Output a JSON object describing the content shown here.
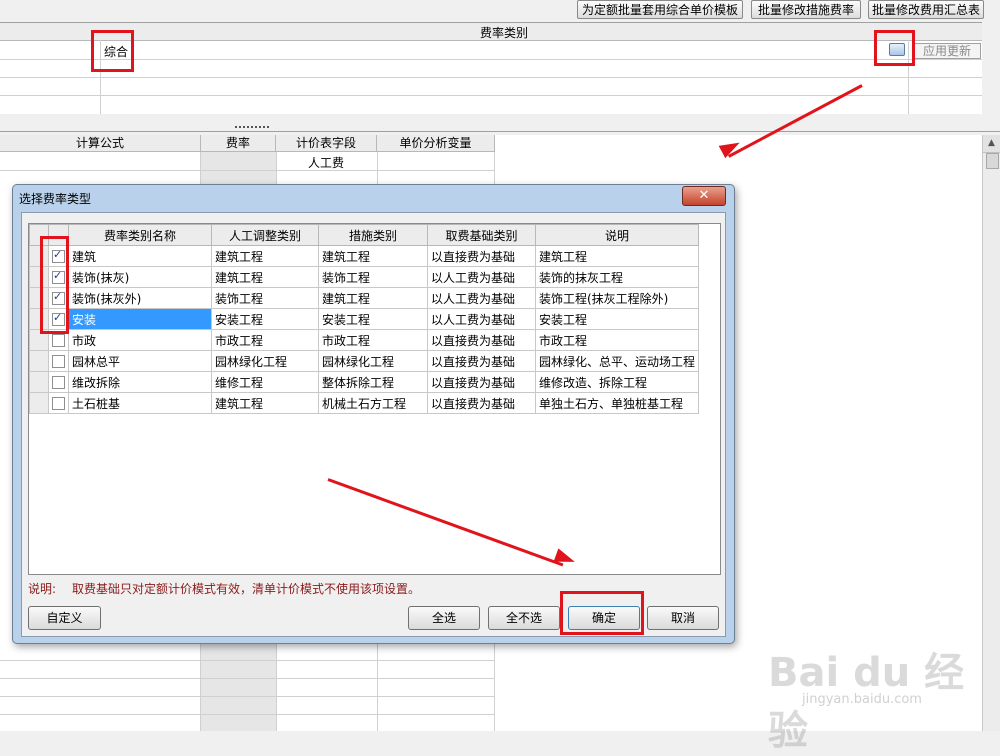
{
  "toolbar": {
    "btn_batch_template": "为定额批量套用综合单价模板",
    "btn_batch_measure_rate": "批量修改措施费率",
    "btn_batch_fee_summary": "批量修改费用汇总表"
  },
  "top_grid": {
    "header": "费率类别",
    "cell_value": "综合",
    "apply_update": "应用更新"
  },
  "lower_grid": {
    "columns": [
      "计算公式",
      "费率",
      "计价表字段",
      "单价分析变量"
    ],
    "first_row_field": "人工费"
  },
  "dialog": {
    "title": "选择费率类型",
    "close_glyph": "✕",
    "columns": [
      "费率类别名称",
      "人工调整类别",
      "措施类别",
      "取费基础类别",
      "说明"
    ],
    "rows": [
      {
        "checked": true,
        "name": "建筑",
        "labor": "建筑工程",
        "measure": "建筑工程",
        "base": "以直接费为基础",
        "desc": "建筑工程"
      },
      {
        "checked": true,
        "name": "装饰(抹灰)",
        "labor": "建筑工程",
        "measure": "装饰工程",
        "base": "以人工费为基础",
        "desc": "装饰的抹灰工程"
      },
      {
        "checked": true,
        "name": "装饰(抹灰外)",
        "labor": "装饰工程",
        "measure": "建筑工程",
        "base": "以人工费为基础",
        "desc": "装饰工程(抹灰工程除外)"
      },
      {
        "checked": true,
        "name": "安装",
        "labor": "安装工程",
        "measure": "安装工程",
        "base": "以人工费为基础",
        "desc": "安装工程"
      },
      {
        "checked": false,
        "name": "市政",
        "labor": "市政工程",
        "measure": "市政工程",
        "base": "以直接费为基础",
        "desc": "市政工程"
      },
      {
        "checked": false,
        "name": "园林总平",
        "labor": "园林绿化工程",
        "measure": "园林绿化工程",
        "base": "以直接费为基础",
        "desc": "园林绿化、总平、运动场工程"
      },
      {
        "checked": false,
        "name": "维改拆除",
        "labor": "维修工程",
        "measure": "整体拆除工程",
        "base": "以直接费为基础",
        "desc": "维修改造、拆除工程"
      },
      {
        "checked": false,
        "name": "土石桩基",
        "labor": "建筑工程",
        "measure": "机械土石方工程",
        "base": "以直接费为基础",
        "desc": "单独土石方、单独桩基工程"
      }
    ],
    "note_label": "说明:",
    "note_text": "取费基础只对定额计价模式有效，清单计价模式不使用该项设置。",
    "btn_custom": "自定义",
    "btn_select_all": "全选",
    "btn_select_none": "全不选",
    "btn_ok": "确定",
    "btn_cancel": "取消"
  },
  "colors": {
    "annotation_red": "#e0141a",
    "selection_blue": "#3399ff",
    "dialog_frame": "#b9d1ea"
  }
}
